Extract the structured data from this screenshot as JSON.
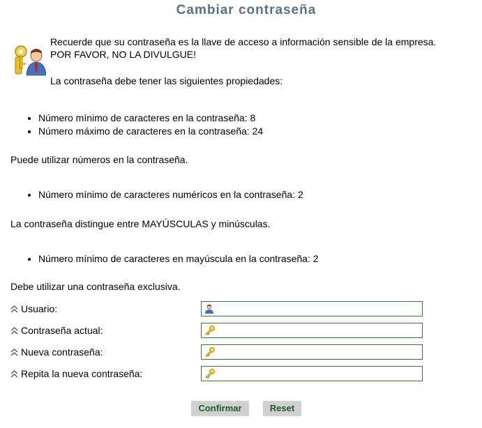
{
  "page": {
    "title": "Cambiar contraseña"
  },
  "intro": {
    "line1": "Recuerde que su contraseña es la llave de acceso a información sensible de la empresa.",
    "line2": "POR FAVOR, NO LA DIVULGUE!",
    "properties_heading": "La contraseña debe tener las siguientes propiedades:"
  },
  "rules": {
    "length": [
      "Número mínimo de caracteres en la contraseña: 8",
      "Número máximo de caracteres en la contraseña: 24"
    ],
    "numbers_note": "Puede utilizar números en la contraseña.",
    "numbers": [
      "Número mínimo de caracteres numéricos en la contraseña: 2"
    ],
    "case_note": "La contraseña distingue entre MAYÚSCULAS y minúsculas.",
    "case": [
      "Número mínimo de caracteres en mayúscula en la contraseña: 2"
    ],
    "exclusive_note": "Debe utilizar una contraseña exclusiva."
  },
  "form": {
    "user_label": "Usuario:",
    "user_value": "",
    "current_label": "Contraseña actual:",
    "current_value": "",
    "new_label": "Nueva contraseña:",
    "new_value": "",
    "repeat_label": "Repita la nueva contraseña:",
    "repeat_value": "",
    "user_icon": "user-icon",
    "key_icon": "key-icon"
  },
  "buttons": {
    "confirm": "Confirmar",
    "reset": "Reset"
  },
  "colors": {
    "title": "#5b6f85",
    "field_border": "#3f6f3f",
    "button_bg": "#d0d0d0",
    "button_text": "#1a5b2c"
  }
}
